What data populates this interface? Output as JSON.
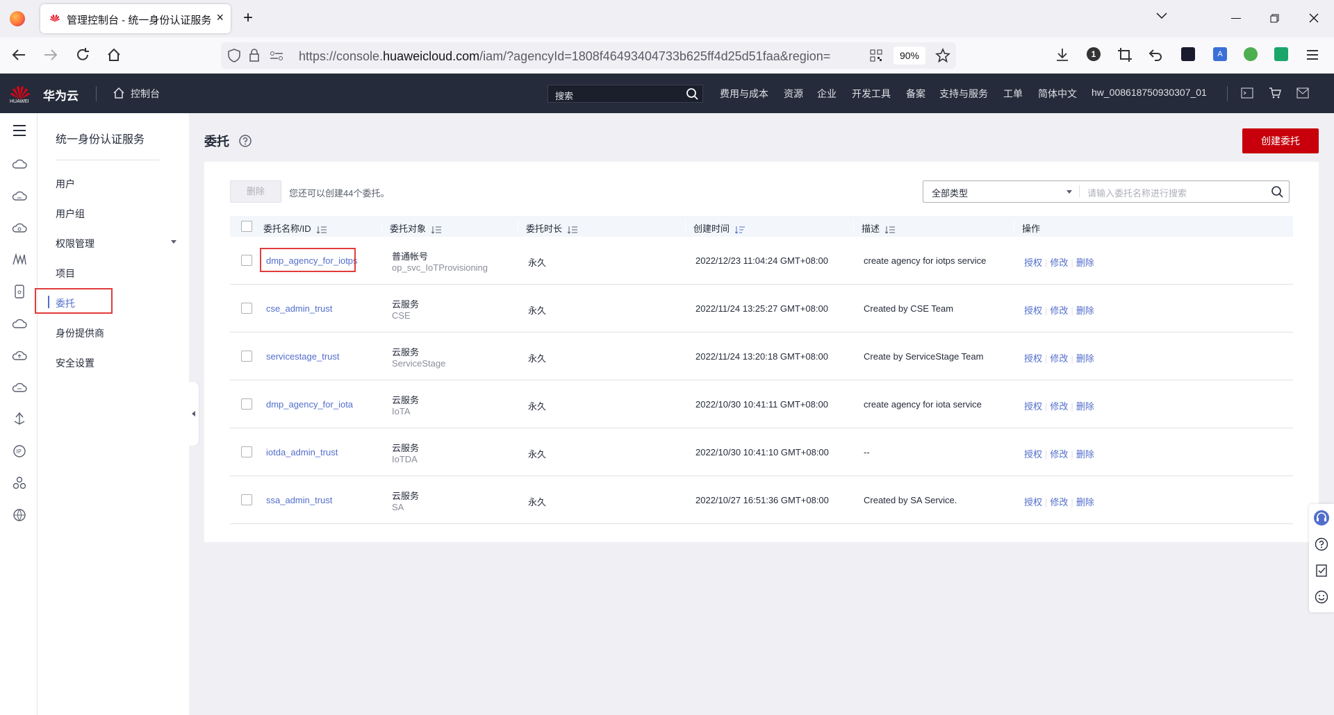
{
  "browser": {
    "tab_title": "管理控制台 - 统一身份认证服务",
    "tab_close": "×",
    "new_tab": "+",
    "url_prefix": "https://console.",
    "url_domain": "huaweicloud.com",
    "url_rest": "/iam/?agencyId=1808f46493404733b625ff4d25d51faa&region=",
    "zoom": "90%",
    "tb_badge": "1"
  },
  "header": {
    "brand": "华为云",
    "logo_text": "HUAWEI",
    "console": "控制台",
    "search_placeholder": "搜索",
    "nav": [
      "费用与成本",
      "资源",
      "企业",
      "开发工具",
      "备案",
      "支持与服务",
      "工单",
      "简体中文"
    ],
    "user": "hw_008618750930307_01"
  },
  "sidebar": {
    "title": "统一身份认证服务",
    "items": [
      "用户",
      "用户组",
      "权限管理",
      "项目",
      "委托",
      "身份提供商",
      "安全设置"
    ],
    "active_index": 4
  },
  "page": {
    "title": "委托",
    "create_button": "创建委托",
    "delete_button": "删除",
    "quota_text": "您还可以创建44个委托。",
    "filter_type": "全部类型",
    "search_placeholder": "请输入委托名称进行搜索"
  },
  "table": {
    "columns": [
      "委托名称/ID",
      "委托对象",
      "委托时长",
      "创建时间",
      "描述",
      "操作"
    ],
    "actions": [
      "授权",
      "修改",
      "删除"
    ],
    "rows": [
      {
        "name": "dmp_agency_for_iotps",
        "target": "普通帐号",
        "target_sub": "op_svc_IoTProvisioning",
        "duration": "永久",
        "created": "2022/12/23 11:04:24 GMT+08:00",
        "desc": "create agency for iotps service"
      },
      {
        "name": "cse_admin_trust",
        "target": "云服务",
        "target_sub": "CSE",
        "duration": "永久",
        "created": "2022/11/24 13:25:27 GMT+08:00",
        "desc": "Created by CSE Team"
      },
      {
        "name": "servicestage_trust",
        "target": "云服务",
        "target_sub": "ServiceStage",
        "duration": "永久",
        "created": "2022/11/24 13:20:18 GMT+08:00",
        "desc": "Create by ServiceStage Team"
      },
      {
        "name": "dmp_agency_for_iota",
        "target": "云服务",
        "target_sub": "IoTA",
        "duration": "永久",
        "created": "2022/10/30 10:41:11 GMT+08:00",
        "desc": "create agency for iota service"
      },
      {
        "name": "iotda_admin_trust",
        "target": "云服务",
        "target_sub": "IoTDA",
        "duration": "永久",
        "created": "2022/10/30 10:41:10 GMT+08:00",
        "desc": "--"
      },
      {
        "name": "ssa_admin_trust",
        "target": "云服务",
        "target_sub": "SA",
        "duration": "永久",
        "created": "2022/10/27 16:51:36 GMT+08:00",
        "desc": "Created by SA Service."
      }
    ]
  }
}
